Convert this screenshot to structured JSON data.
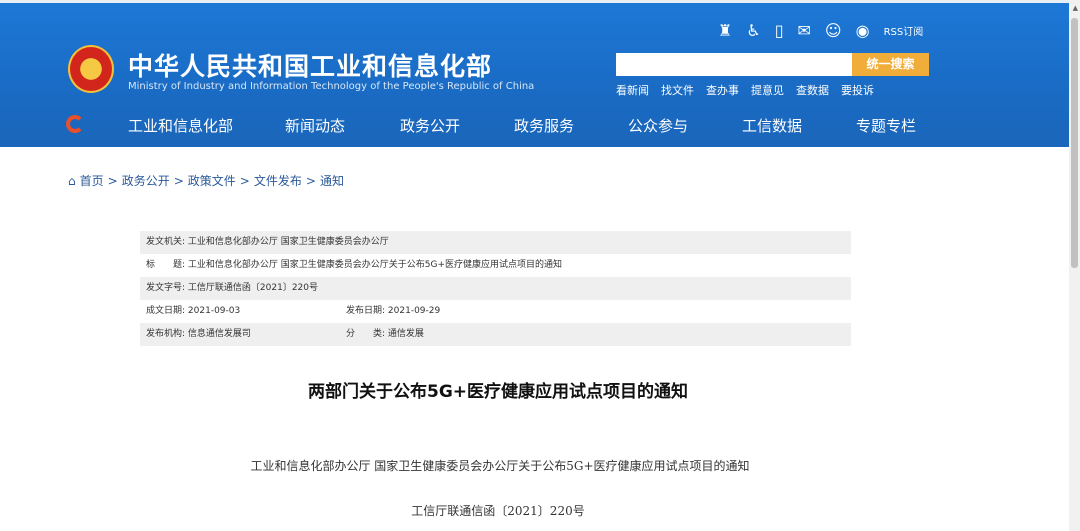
{
  "header": {
    "title_cn": "中华人民共和国工业和信息化部",
    "title_en": "Ministry of Industry and Information Technology of the People's Republic of China",
    "rss": "RSS订阅",
    "search_button": "统一搜索",
    "search_value": "",
    "quick_links": [
      "看新闻",
      "找文件",
      "查办事",
      "提意见",
      "查数据",
      "要投诉"
    ]
  },
  "nav": [
    "工业和信息化部",
    "新闻动态",
    "政务公开",
    "政务服务",
    "公众参与",
    "工信数据",
    "专题专栏"
  ],
  "breadcrumb": {
    "home": "首页",
    "items": [
      "政务公开",
      "政策文件",
      "文件发布",
      "通知"
    ]
  },
  "meta": {
    "issuer_label": "发文机关:",
    "issuer": "工业和信息化部办公厅 国家卫生健康委员会办公厅",
    "title_label": "标　　题:",
    "title": "工业和信息化部办公厅 国家卫生健康委员会办公厅关于公布5G+医疗健康应用试点项目的通知",
    "docno_label": "发文字号:",
    "docno": "工信厅联通信函〔2021〕220号",
    "written_label": "成文日期:",
    "written": "2021-09-03",
    "published_label": "发布日期:",
    "published": "2021-09-29",
    "org_label": "发布机构:",
    "org": "信息通信发展司",
    "cat_label": "分　　类:",
    "cat": "通信发展"
  },
  "article": {
    "heading": "两部门关于公布5G+医疗健康应用试点项目的通知",
    "subtitle": "工业和信息化部办公厅 国家卫生健康委员会办公厅关于公布5G+医疗健康应用试点项目的通知",
    "docno": "工信厅联通信函〔2021〕220号"
  }
}
